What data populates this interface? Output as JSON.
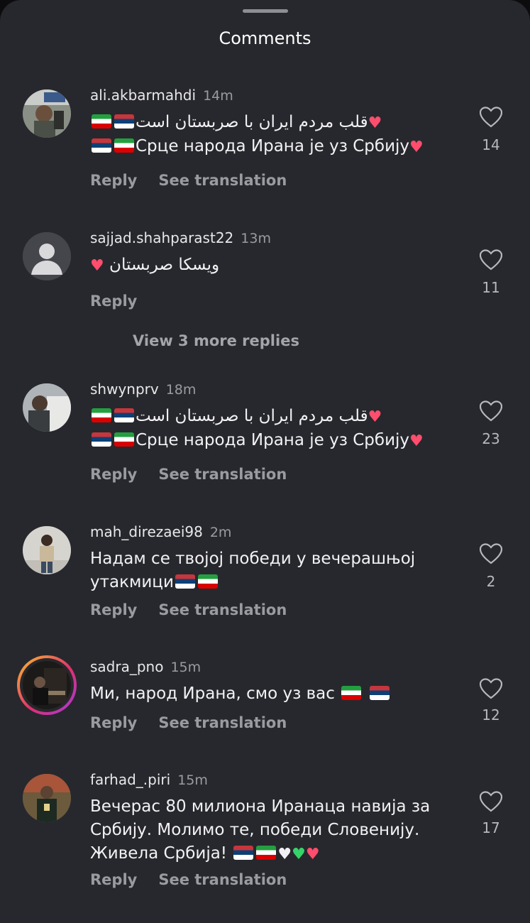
{
  "header": {
    "title": "Comments"
  },
  "actions": {
    "reply": "Reply",
    "see_translation": "See translation"
  },
  "view_more_replies": "View 3 more replies",
  "comments": [
    {
      "username": "ali.akbarmahdi",
      "time": "14m",
      "line1": "قلب مردم ایران با صربستان است",
      "line2": "Срце народа Ирана је уз Србију",
      "likes": "14"
    },
    {
      "username": "sajjad.shahparast22",
      "time": "13m",
      "line1": "ویسکا صربستان",
      "likes": "11"
    },
    {
      "username": "shwynprv",
      "time": "18m",
      "line1": "قلب مردم ایران با صربستان است",
      "line2": "Срце народа Ирана је уз Србију",
      "likes": "23"
    },
    {
      "username": "mah_direzaei98",
      "time": "2m",
      "line1": "Надам се твојој победи у вечерашњој",
      "line2": "утакмици",
      "likes": "2"
    },
    {
      "username": "sadra_pno",
      "time": "15m",
      "line1": "Ми, народ Ирана, смо уз вас",
      "likes": "12"
    },
    {
      "username": "farhad_.piri",
      "time": "15m",
      "line1": "Вечерас 80 милиона Иранаца навија за",
      "line2": "Србију. Молимо те, победи Словенију.",
      "line3": "Живела Србија!",
      "likes": "17"
    }
  ],
  "icons": {
    "like": "heart-outline-icon",
    "flag_iran": "iran-flag-icon",
    "flag_serbia": "serbia-flag-icon"
  },
  "colors": {
    "sheet_bg": "#27282d",
    "heart_emoji": "#ff4d6d",
    "muted_text": "#9a9ba1"
  }
}
